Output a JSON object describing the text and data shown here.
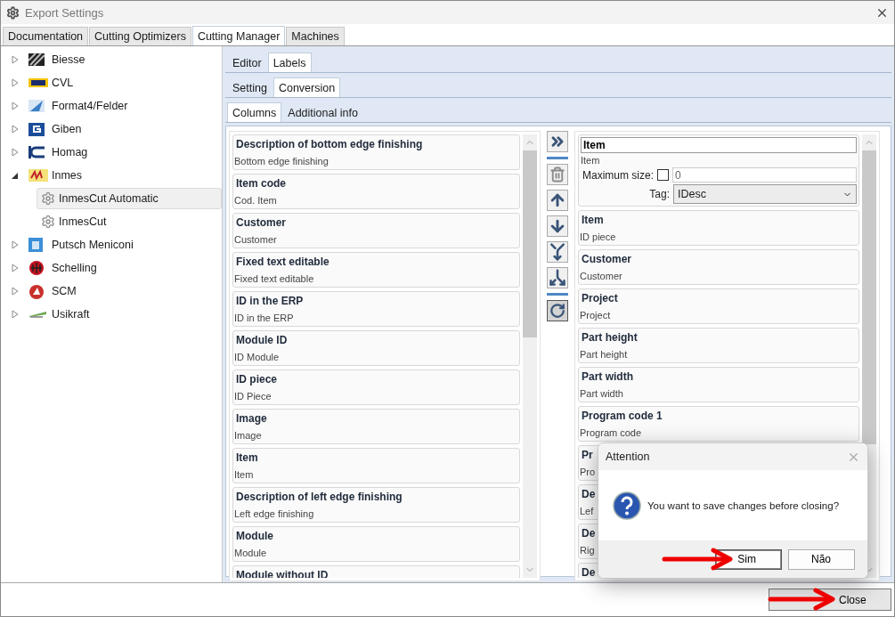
{
  "window": {
    "title": "Export Settings"
  },
  "main_tabs": [
    {
      "label": "Documentation",
      "selected": false
    },
    {
      "label": "Cutting Optimizers",
      "selected": false
    },
    {
      "label": "Cutting Manager",
      "selected": true
    },
    {
      "label": "Machines",
      "selected": false
    }
  ],
  "tree": [
    {
      "label": "Biesse",
      "expanded": false,
      "selected": false
    },
    {
      "label": "CVL",
      "expanded": false,
      "selected": false
    },
    {
      "label": "Format4/Felder",
      "expanded": false,
      "selected": false
    },
    {
      "label": "Giben",
      "expanded": false,
      "selected": false
    },
    {
      "label": "Homag",
      "expanded": false,
      "selected": false
    },
    {
      "label": "Inmes",
      "expanded": true,
      "selected": false,
      "children": [
        {
          "label": "InmesCut Automatic",
          "selected": true
        },
        {
          "label": "InmesCut",
          "selected": false
        }
      ]
    },
    {
      "label": "Putsch Meniconi",
      "expanded": false,
      "selected": false
    },
    {
      "label": "Schelling",
      "expanded": false,
      "selected": false
    },
    {
      "label": "SCM",
      "expanded": false,
      "selected": false
    },
    {
      "label": "Usikraft",
      "expanded": false,
      "selected": false
    }
  ],
  "editor_tabs": [
    {
      "label": "Editor",
      "selected": false
    },
    {
      "label": "Labels",
      "selected": true
    }
  ],
  "label_tabs": [
    {
      "label": "Setting",
      "selected": false
    },
    {
      "label": "Conversion",
      "selected": true
    }
  ],
  "conversion_tabs": [
    {
      "label": "Columns",
      "selected": true
    },
    {
      "label": "Additional info",
      "selected": false
    }
  ],
  "available_columns": [
    {
      "title": "Description of bottom edge finishing",
      "subtitle": "Bottom edge finishing"
    },
    {
      "title": "Item code",
      "subtitle": "Cod. Item"
    },
    {
      "title": "Customer",
      "subtitle": "Customer"
    },
    {
      "title": "Fixed text editable",
      "subtitle": "Fixed text editable"
    },
    {
      "title": "ID in the ERP",
      "subtitle": "ID in the ERP"
    },
    {
      "title": "Module ID",
      "subtitle": "ID Module"
    },
    {
      "title": "ID piece",
      "subtitle": "ID Piece"
    },
    {
      "title": "Image",
      "subtitle": "Image"
    },
    {
      "title": "Item",
      "subtitle": "Item"
    },
    {
      "title": "Description of left edge finishing",
      "subtitle": "Left edge finishing"
    },
    {
      "title": "Module",
      "subtitle": "Module"
    },
    {
      "title": "Module without ID"
    }
  ],
  "toolbar": [
    {
      "kind": "add-all",
      "disabled": false
    },
    {
      "kind": "separator"
    },
    {
      "kind": "delete",
      "disabled": true
    },
    {
      "kind": "up",
      "disabled": false
    },
    {
      "kind": "down",
      "disabled": false
    },
    {
      "kind": "merge",
      "disabled": false
    },
    {
      "kind": "split",
      "disabled": false
    },
    {
      "kind": "separator"
    },
    {
      "kind": "refresh",
      "disabled": false
    }
  ],
  "selected_columns": [
    {
      "kind": "editor",
      "value": "Item",
      "subtitle": "Item",
      "max_size_label": "Maximum size:",
      "max_size_checked": false,
      "max_size_value": "0",
      "tag_label": "Tag:",
      "tag_value": "IDesc"
    },
    {
      "kind": "card",
      "title": "Item",
      "subtitle": "ID piece"
    },
    {
      "kind": "card",
      "title": "Customer",
      "subtitle": "Customer"
    },
    {
      "kind": "card",
      "title": "Project",
      "subtitle": "Project"
    },
    {
      "kind": "card",
      "title": "Part height",
      "subtitle": "Part height"
    },
    {
      "kind": "card",
      "title": "Part width",
      "subtitle": "Part width"
    },
    {
      "kind": "card",
      "title": "Program code 1",
      "subtitle": "Program code"
    },
    {
      "kind": "card",
      "title": "Pr",
      "subtitle": "Pro"
    },
    {
      "kind": "card",
      "title": "De",
      "subtitle": "Lef"
    },
    {
      "kind": "card",
      "title": "De",
      "subtitle": "Rig"
    },
    {
      "kind": "card",
      "title": "De"
    }
  ],
  "footer": {
    "close_button": "Close"
  },
  "dialog": {
    "title": "Attention",
    "message": "You want to save changes before closing?",
    "buttons": [
      {
        "label": "Sim",
        "selected": true
      },
      {
        "label": "Não",
        "selected": false
      }
    ]
  }
}
